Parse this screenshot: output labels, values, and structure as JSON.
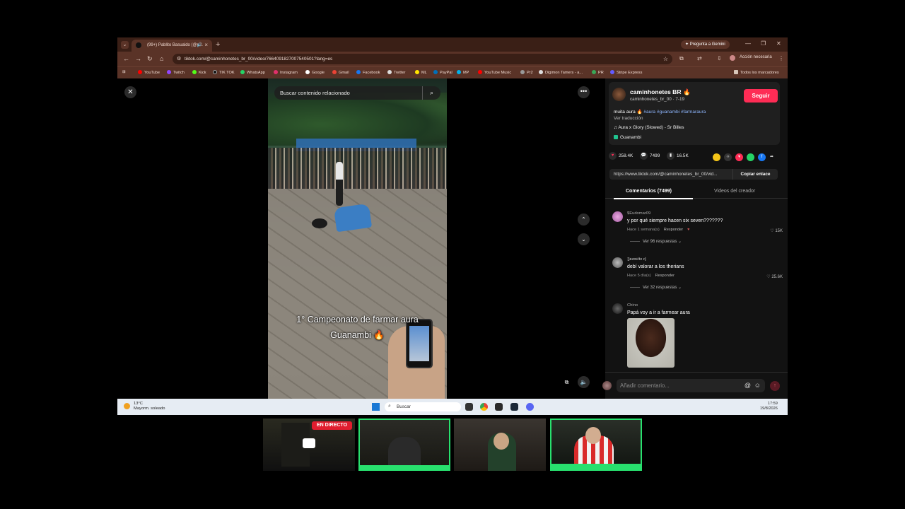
{
  "browser": {
    "tab_title": "(99+) Pablito Basualdo (@p...",
    "gemini_label": "Pregunta a Gemini",
    "url": "tiktok.com/@caminhonetes_br_00/video/7664091827007540501?lang=es",
    "action_label": "Acción necesaria",
    "bookmarks": [
      {
        "label": "YouTube",
        "color": "#ff0000"
      },
      {
        "label": "Twitch",
        "color": "#9146ff"
      },
      {
        "label": "Kick",
        "color": "#53fc18"
      },
      {
        "label": "TIK TOK",
        "color": "#111111"
      },
      {
        "label": "WhatsApp",
        "color": "#25d366"
      },
      {
        "label": "Instagram",
        "color": "#e1306c"
      },
      {
        "label": "Google",
        "color": "#ffffff"
      },
      {
        "label": "Gmail",
        "color": "#ea4335"
      },
      {
        "label": "Facebook",
        "color": "#1877f2"
      },
      {
        "label": "Twitter",
        "color": "#dddddd"
      },
      {
        "label": "ML",
        "color": "#ffe600"
      },
      {
        "label": "PayPal",
        "color": "#0070ba"
      },
      {
        "label": "MP",
        "color": "#00b1ea"
      },
      {
        "label": "YouTube Music",
        "color": "#ff0000"
      },
      {
        "label": "Pr2",
        "color": "#999999"
      },
      {
        "label": "Digimon Tamers - a...",
        "color": "#dddddd"
      },
      {
        "label": "PR",
        "color": "#3aa757"
      },
      {
        "label": "Stripe Express",
        "color": "#635bff"
      }
    ],
    "all_bookmarks": "Todos los marcadores"
  },
  "video": {
    "search_placeholder": "Buscar contenido relacionado",
    "caption_line1": "1° Campeonato de farmar aura",
    "caption_line2": "Guanambi 🔥"
  },
  "post": {
    "display_name": "caminhonetes BR 🔥",
    "handle_date": "caminhonetes_br_00 · 7-19",
    "follow_label": "Seguir",
    "desc_text": "muita aura 🔥 ",
    "desc_tags": "#aura #guanambi #farmaraura",
    "translate_label": "Ver traducción",
    "music": "♫  Aura x Glory (Slowed) - Sr Billes",
    "place": "Guanambi",
    "likes": "258.4K",
    "comments_count": "7499",
    "saves": "16.5K",
    "link": "https://www.tiktok.com/@caminhonetes_br_00/vid...",
    "copy_link_label": "Copiar enlace",
    "tab_comments": "Comentarios (7499)",
    "tab_creator": "Videos del creador"
  },
  "comments": [
    {
      "user": "$Eudomar09",
      "text": "y por qué siempre hacen six seven???????",
      "time": "Hace 1 semana(s)",
      "reply": "Responder",
      "likes": "15K",
      "more": "Ver 96 respuestas"
    },
    {
      "user": "𝕵𝖚𝖆𝖓𝖘𝖎𝖙𝖔 𝖊𝖏",
      "text": "debí valorar a los therians",
      "time": "Hace 5 día(s)",
      "reply": "Responder",
      "likes": "25.6K",
      "more": "Ver 32 respuestas"
    },
    {
      "user": "Chino",
      "text": "Papá voy a ir a farmear aura"
    }
  ],
  "comment_input_placeholder": "Añadir comentario...",
  "taskbar": {
    "temp": "13°C",
    "weather": "Mayorm. soleado",
    "search": "Buscar",
    "time": "17:59",
    "date": "19/8/2026"
  },
  "stream": {
    "live_badge": "EN DIRECTO"
  }
}
